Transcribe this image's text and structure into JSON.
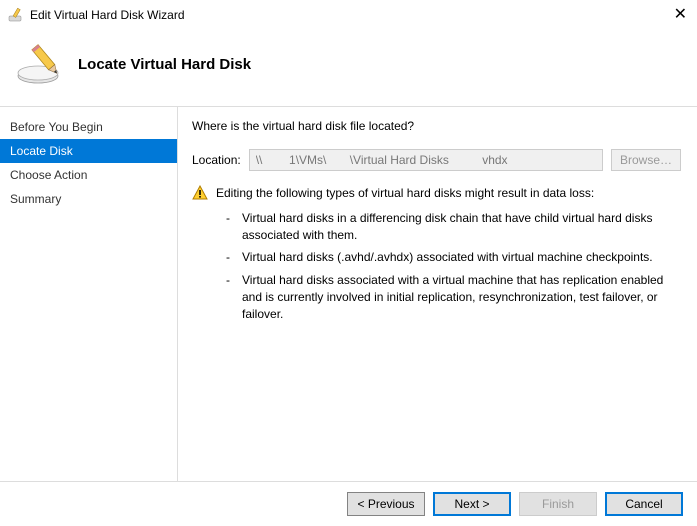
{
  "window": {
    "title": "Edit Virtual Hard Disk Wizard"
  },
  "header": {
    "title": "Locate Virtual Hard Disk"
  },
  "sidebar": {
    "items": [
      {
        "label": "Before You Begin"
      },
      {
        "label": "Locate Disk"
      },
      {
        "label": "Choose Action"
      },
      {
        "label": "Summary"
      }
    ]
  },
  "main": {
    "question": "Where is the virtual hard disk file located?",
    "location_label": "Location:",
    "location_value": "\\\\        1\\VMs\\       \\Virtual Hard Disks          vhdx",
    "browse_label": "Browse…",
    "warning_intro": "Editing the following types of virtual hard disks might result in data loss:",
    "warning_items": [
      "Virtual hard disks in a differencing disk chain that have child virtual hard disks associated with them.",
      "Virtual hard disks (.avhd/.avhdx) associated with virtual machine checkpoints.",
      "Virtual hard disks associated with a virtual machine that has replication enabled and is currently involved in initial replication, resynchronization, test failover, or failover."
    ]
  },
  "footer": {
    "previous": "< Previous",
    "next": "Next >",
    "finish": "Finish",
    "cancel": "Cancel"
  }
}
